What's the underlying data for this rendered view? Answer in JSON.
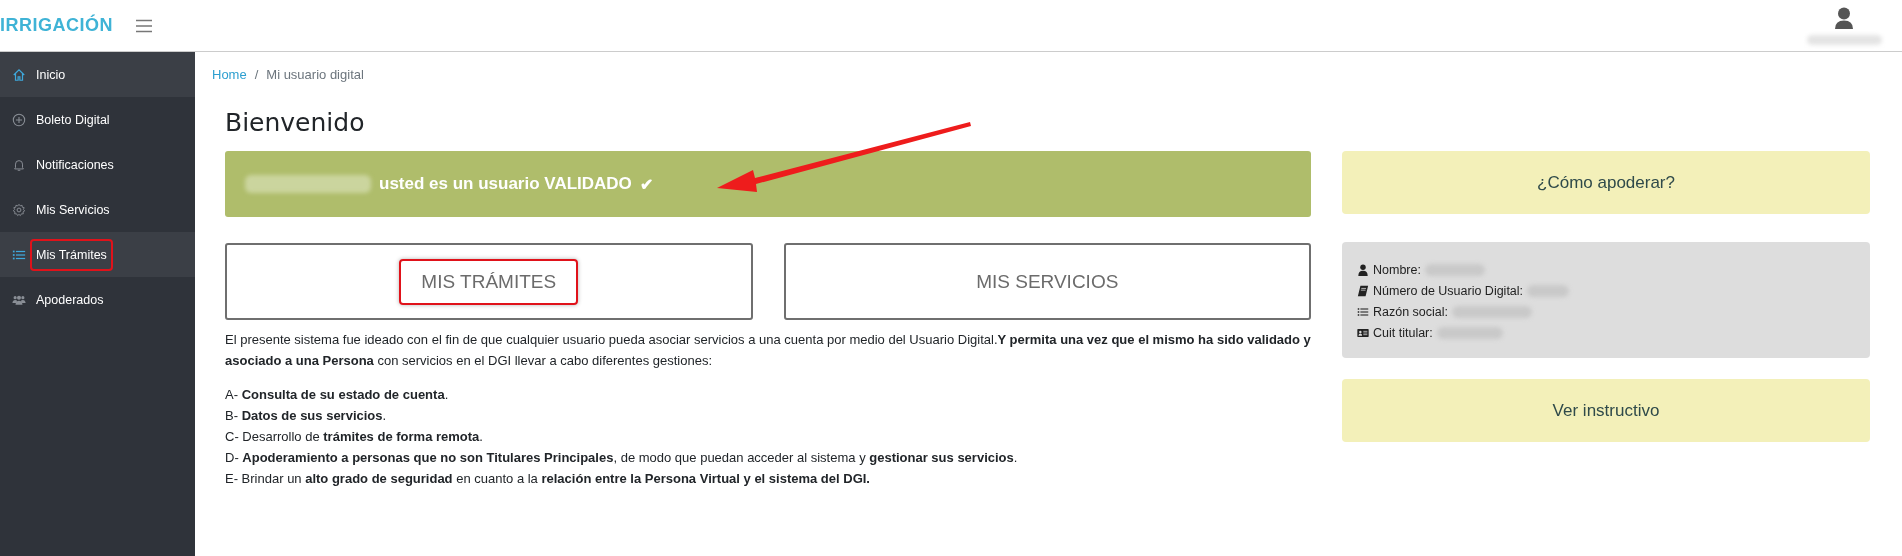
{
  "header": {
    "logo": "IRRIGACIÓN"
  },
  "sidebar": {
    "items": [
      {
        "label": "Inicio",
        "kind": "home",
        "selected": true,
        "highlighted": false
      },
      {
        "label": "Boleto Digital",
        "kind": "plus",
        "selected": false,
        "highlighted": false
      },
      {
        "label": "Notificaciones",
        "kind": "bell",
        "selected": false,
        "highlighted": false
      },
      {
        "label": "Mis Servicios",
        "kind": "gear",
        "selected": false,
        "highlighted": false
      },
      {
        "label": "Mis Trámites",
        "kind": "list",
        "selected": true,
        "highlighted": true
      },
      {
        "label": "Apoderados",
        "kind": "users",
        "selected": false,
        "highlighted": false
      }
    ]
  },
  "breadcrumb": [
    {
      "label": "Home",
      "kind": "link"
    },
    {
      "label": "/",
      "kind": "separator"
    },
    {
      "label": "Mi usuario digital",
      "kind": "current"
    }
  ],
  "heading": "Bienvenido",
  "banner": {
    "text": "usted es un usuario VALIDADO",
    "check": "✔"
  },
  "buttons": [
    {
      "label": "MIS TRÁMITES",
      "highlighted": true
    },
    {
      "label": "MIS SERVICIOS",
      "highlighted": false
    }
  ],
  "intro": "El presente sistema fue ideado con el fin de que cualquier usuario pueda asociar servicios a una cuenta por medio del Usuario Digital.**Y permita una vez que el mismo ha sido validado y asociado a una Persona** con servicios en el DGI llevar a cabo diferentes gestiones:",
  "list": [
    "A- **Consulta de su estado de cuenta**.",
    "B- **Datos de sus servicios**.",
    "C- Desarrollo de **trámites de forma remota**.",
    "D- **Apoderamiento a personas que no son Titulares Principales**, de modo que puedan acceder al sistema y **gestionar sus servicios**.",
    "E- Brindar un **alto grado de seguridad** en cuanto a la **relación entre la Persona Virtual y el sistema del DGI.**"
  ],
  "side_buttons": [
    {
      "label": "¿Cómo apoderar?"
    },
    {
      "label": "Ver instructivo"
    }
  ],
  "info": [
    {
      "kind": "person",
      "label": "Nombre:"
    },
    {
      "kind": "book",
      "label": "Número de Usuario Digital:"
    },
    {
      "kind": "list",
      "label": "Razón social:"
    },
    {
      "kind": "card",
      "label": "Cuit titular:"
    }
  ]
}
